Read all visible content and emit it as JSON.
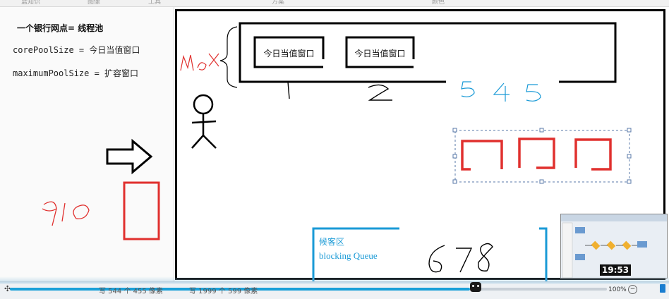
{
  "top_tabs": [
    "蓝知识",
    "图像",
    "工具",
    "方案",
    "颜色"
  ],
  "left_panel": {
    "title": "一个银行网点= 线程池",
    "line1": "corePoolSize = 今日当值窗口",
    "line2": "maximumPoolSize = 扩容窗口"
  },
  "canvas": {
    "window1_label": "今日当值窗口",
    "window2_label": "今日当值窗口",
    "queue_title": "候客区",
    "queue_subtitle": "blocking Queue"
  },
  "video": {
    "timer": "19:53",
    "progress_fraction": 0.78,
    "zoom": "100%",
    "status_left": "写 544 个 455 像素",
    "status_mid": "写 1999 个 599 像素"
  },
  "colors": {
    "accent_blue": "#1a9ad6",
    "ink_red": "#e0302e",
    "ink_black": "#000000"
  }
}
